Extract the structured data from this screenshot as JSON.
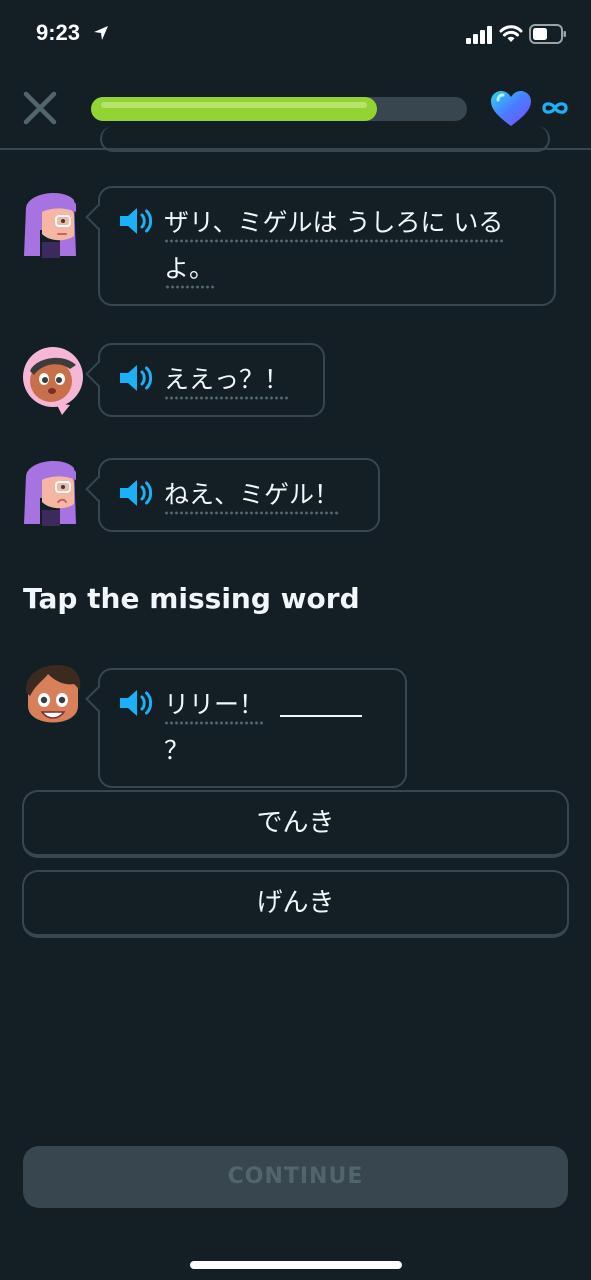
{
  "status_bar": {
    "time": "9:23"
  },
  "header": {
    "progress_fraction": 0.76,
    "hearts": "∞",
    "colors": {
      "progress": "#93d333",
      "track": "#37464f",
      "infinity": "#1cb0f6"
    }
  },
  "messages": [
    {
      "speaker": "lily",
      "text": "ザリ、ミゲルは うしろに いるよ。"
    },
    {
      "speaker": "zari",
      "text": "ええっ？！"
    },
    {
      "speaker": "lily",
      "text": "ねえ、ミゲル！"
    }
  ],
  "instruction": "Tap the missing word",
  "prompt": {
    "speaker": "miguel",
    "text_before": "リリー！",
    "text_after": "？"
  },
  "options": [
    {
      "label": "でんき"
    },
    {
      "label": "げんき"
    }
  ],
  "continue_label": "CONTINUE"
}
